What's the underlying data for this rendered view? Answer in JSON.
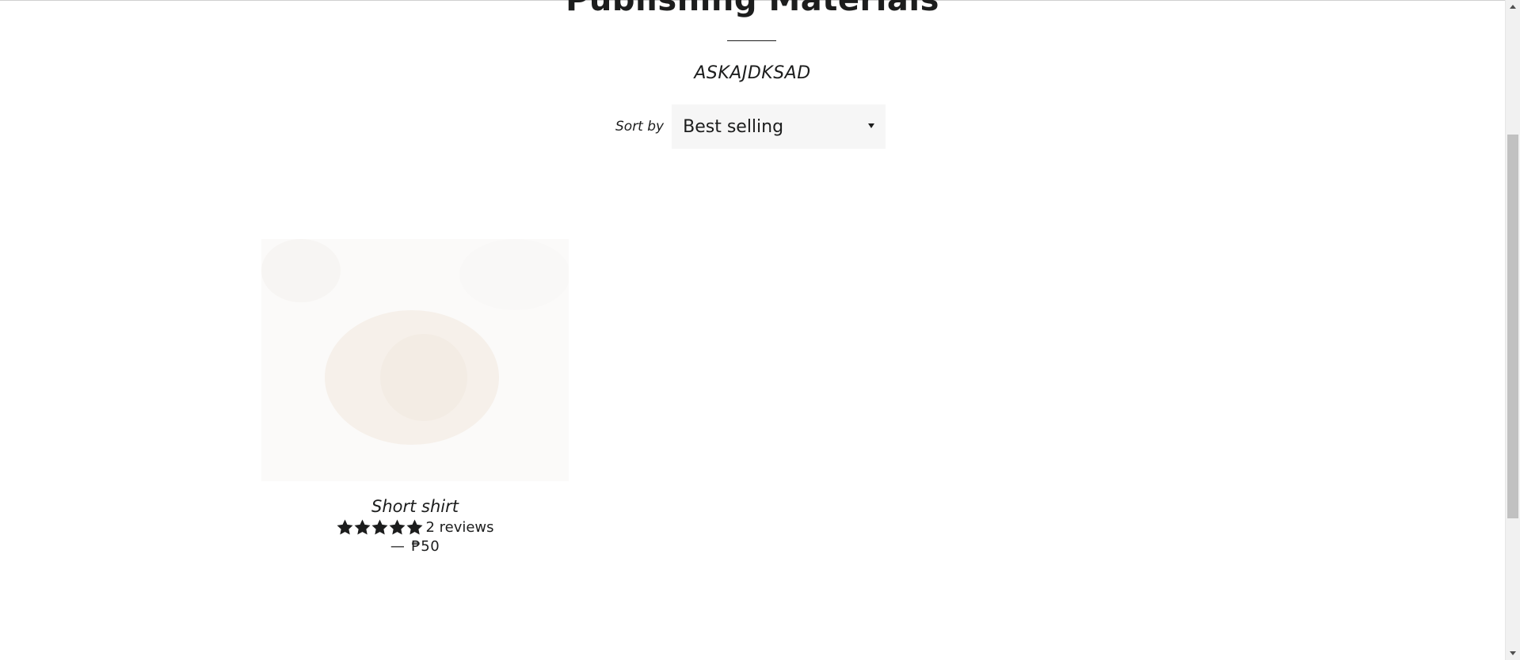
{
  "collection": {
    "title": "Publishing Materials",
    "description": "ASKAJDKSAD"
  },
  "sort": {
    "label": "Sort by",
    "selected": "Best selling"
  },
  "product": {
    "title": "Short shirt",
    "rating": 5,
    "rating_max": 5,
    "reviews_text": "2 reviews",
    "price_dash": "—",
    "price": "₱50"
  },
  "colors": {
    "text": "#1c1d1d",
    "select_bg": "#f6f6f6"
  }
}
